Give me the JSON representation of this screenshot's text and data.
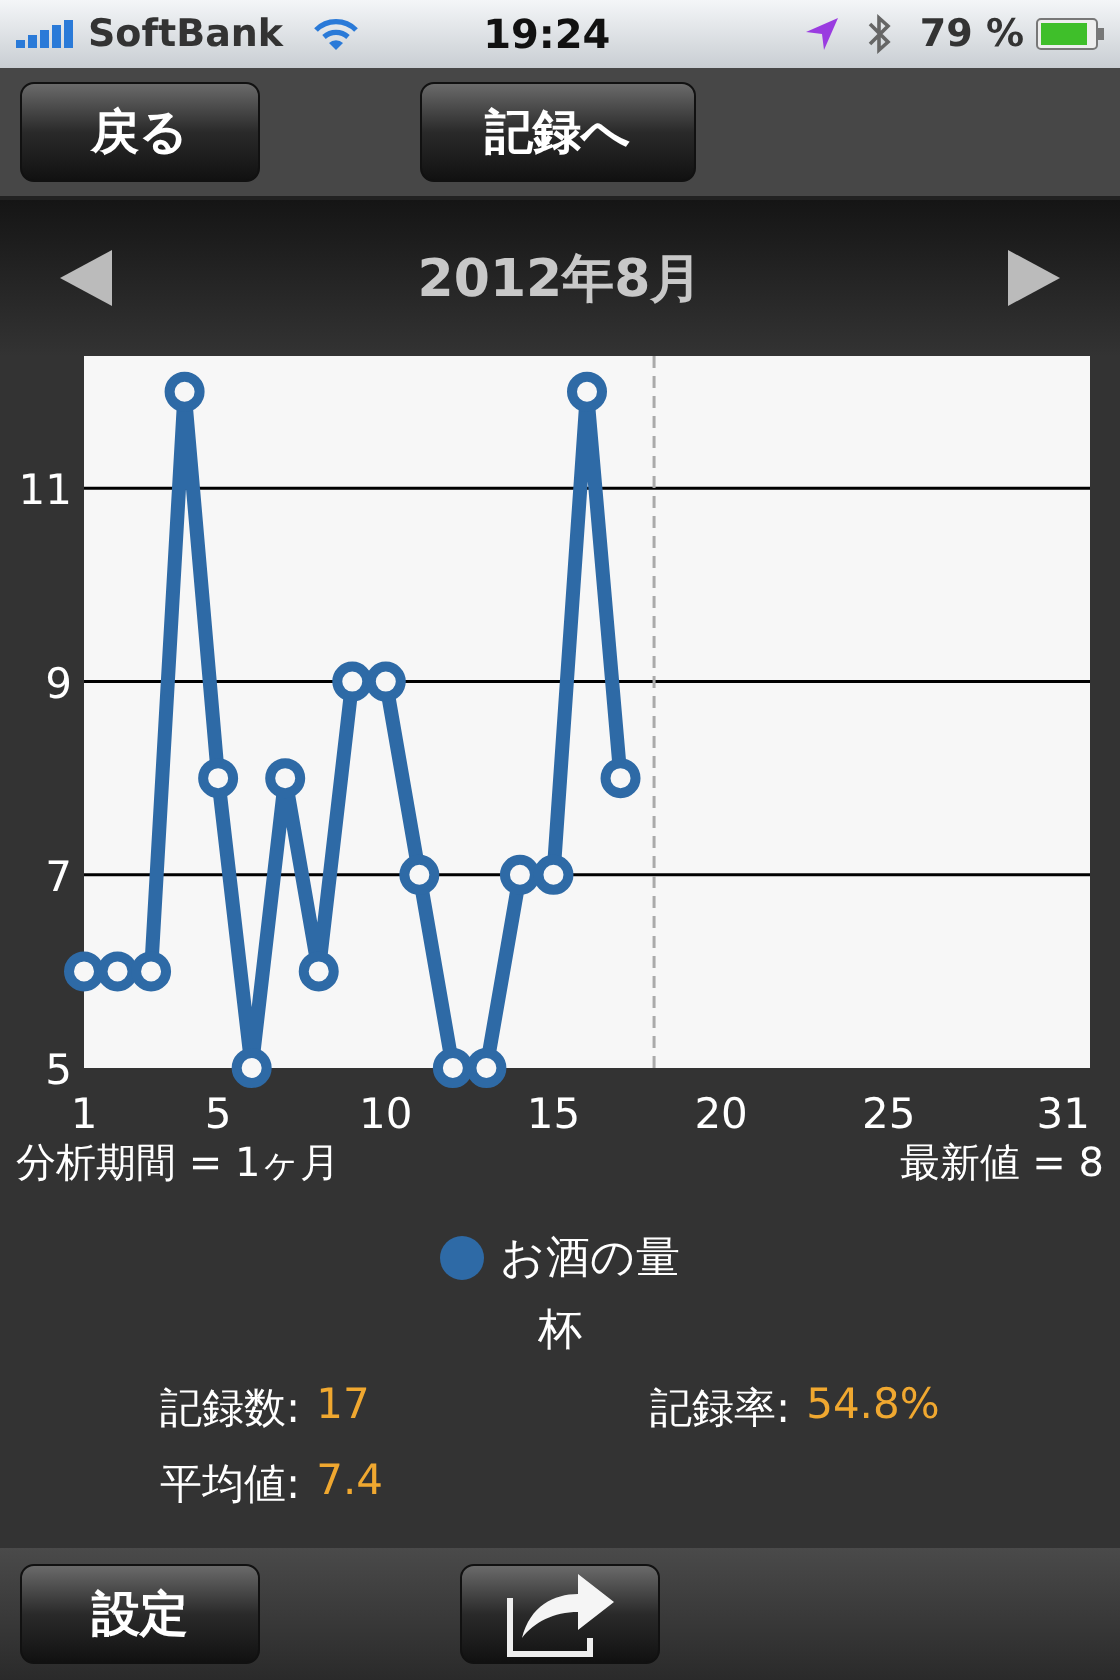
{
  "status_bar": {
    "carrier": "SoftBank",
    "time": "19:24",
    "battery": "79 %"
  },
  "toolbar": {
    "buttons": [
      "戻る",
      "記録へ"
    ]
  },
  "month_header": {
    "title": "2012年8月"
  },
  "chart_data": {
    "type": "line",
    "x": [
      1,
      2,
      3,
      4,
      5,
      6,
      7,
      8,
      9,
      10,
      11,
      12,
      13,
      14,
      15,
      16,
      17
    ],
    "series": [
      {
        "name": "お酒の量",
        "color": "#2e6aa6",
        "marker": "circle",
        "values": [
          6,
          6,
          6,
          12,
          8,
          5,
          8,
          6,
          9,
          9,
          7,
          5,
          5,
          7,
          7,
          12,
          8
        ]
      }
    ],
    "grid": true,
    "xlim": [
      1,
      31
    ],
    "ylim": [
      5,
      12.37
    ],
    "xticks": [
      1,
      5,
      10,
      15,
      20,
      25,
      31
    ],
    "yticks": [
      5,
      7,
      9,
      11
    ],
    "ref_lines": [
      {
        "axis": "x",
        "value": 18
      }
    ]
  },
  "summary": {
    "period": "分析期間 = 1ヶ月",
    "latest": "最新値 = 8"
  },
  "unit": "杯",
  "stats": [
    {
      "label": "記録数:",
      "value": "17"
    },
    {
      "label": "記録率:",
      "value": "54.8%"
    },
    {
      "label": "平均値:",
      "value": "7.4"
    }
  ],
  "bottom_bar": {
    "settings": "設定"
  }
}
